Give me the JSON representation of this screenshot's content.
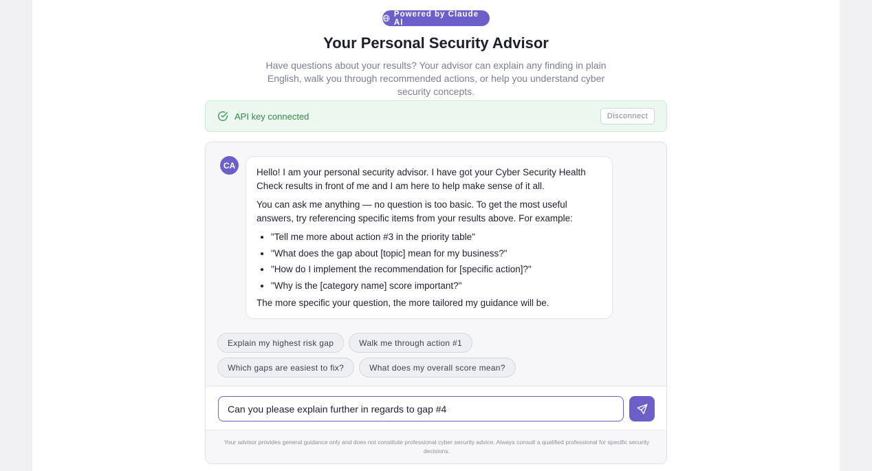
{
  "header": {
    "badge_icon": "globe-icon",
    "badge_text": "Powered by Claude AI",
    "title": "Your Personal Security Advisor",
    "subtitle": "Have questions about your results? Your advisor can explain any finding in plain English, walk you through recommended actions, or help you understand cyber security concepts."
  },
  "api": {
    "icon": "check-circle-icon",
    "status": "API key connected",
    "disconnect_label": "Disconnect"
  },
  "chat": {
    "avatar_initials": "CA",
    "message": {
      "intro": "Hello! I am your personal security advisor. I have got your Cyber Security Health Check results in front of me and I am here to help make sense of it all.",
      "prompt": "You can ask me anything — no question is too basic. To get the most useful answers, try referencing specific items from your results above. For example:",
      "examples": [
        "\"Tell me more about action #3 in the priority table\"",
        "\"What does the gap about [topic] mean for my business?\"",
        "\"How do I implement the recommendation for [specific action]?\"",
        "\"Why is the [category name] score important?\""
      ],
      "closing": "The more specific your question, the more tailored my guidance will be."
    },
    "suggestions": [
      "Explain my highest risk gap",
      "Walk me through action #1",
      "Which gaps are easiest to fix?",
      "What does my overall score mean?"
    ],
    "input_value": "Can you please explain further in regards to gap #4",
    "send_icon": "send-icon",
    "disclaimer": "Your advisor provides general guidance only and does not constitute professional cyber security advice. Always consult a qualified professional for specific security decisions."
  },
  "colors": {
    "accent": "#6b5fc9",
    "success": "#2f8a48",
    "success_bg": "#ecf8ef"
  }
}
